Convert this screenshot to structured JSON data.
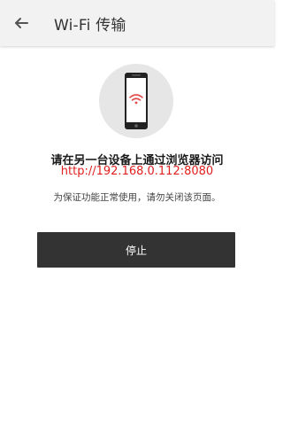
{
  "app_bar": {
    "title": "Wi-Fi 传输",
    "back_icon": "arrow-left-icon"
  },
  "illustration": {
    "icon": "phone-wifi-icon",
    "wifi_color": "#e34b4b",
    "circle_color": "#e6e6e6"
  },
  "content": {
    "headline": "请在另一台设备上通过浏览器访问",
    "url": "http://192.168.0.112:8080",
    "note": "为保证功能正常使用，请勿关闭该页面。"
  },
  "actions": {
    "stop_label": "停止"
  },
  "colors": {
    "url": "#e02020",
    "button_bg": "#333333",
    "app_bar_bg": "#f2f2f2"
  }
}
